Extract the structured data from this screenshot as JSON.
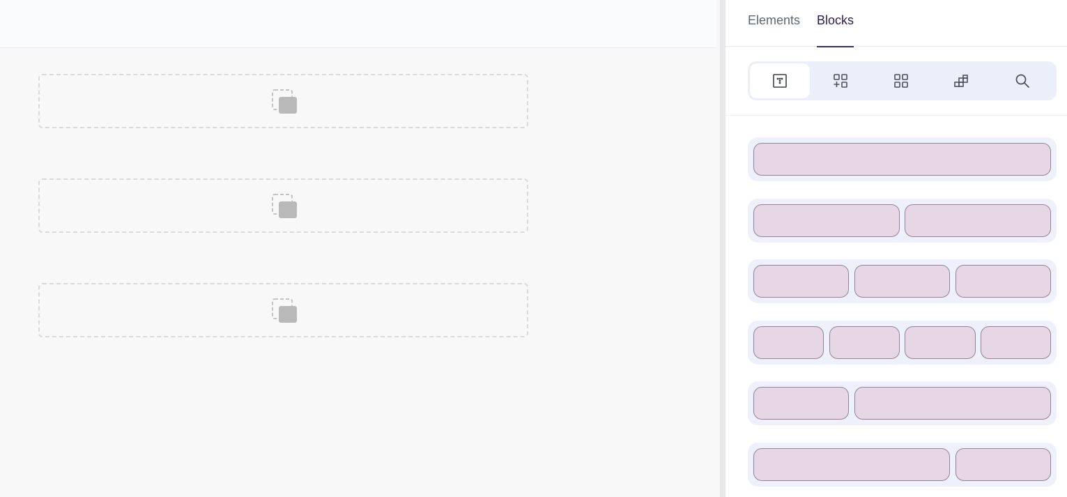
{
  "panel": {
    "tabs": [
      {
        "label": "Elements",
        "active": false
      },
      {
        "label": "Blocks",
        "active": true
      }
    ]
  },
  "toolbar": {
    "tools": [
      {
        "icon": "grid-dots-icon",
        "active": true
      },
      {
        "icon": "grid-add-icon",
        "active": false
      },
      {
        "icon": "grid-four-icon",
        "active": false
      },
      {
        "icon": "stacked-blocks-icon",
        "active": false
      },
      {
        "icon": "search-icon",
        "active": false
      }
    ]
  },
  "canvas": {
    "drop_zones": [
      {
        "icon": "placeholder-block-icon"
      },
      {
        "icon": "placeholder-block-icon"
      },
      {
        "icon": "placeholder-block-icon"
      }
    ]
  },
  "layouts": [
    {
      "name": "one-column",
      "columns": [
        1
      ]
    },
    {
      "name": "two-columns",
      "columns": [
        1,
        1
      ]
    },
    {
      "name": "three-columns",
      "columns": [
        1,
        1,
        1
      ]
    },
    {
      "name": "four-columns",
      "columns": [
        1,
        1,
        1,
        1
      ]
    },
    {
      "name": "one-third-two-thirds",
      "columns": [
        1,
        2
      ]
    },
    {
      "name": "two-thirds-one-third",
      "columns": [
        2,
        1
      ]
    }
  ],
  "colors": {
    "accent": "#3b2a68",
    "cell_fill": "#e7d6e6",
    "cell_border": "#8e8597",
    "row_bg": "#eef0fb"
  }
}
